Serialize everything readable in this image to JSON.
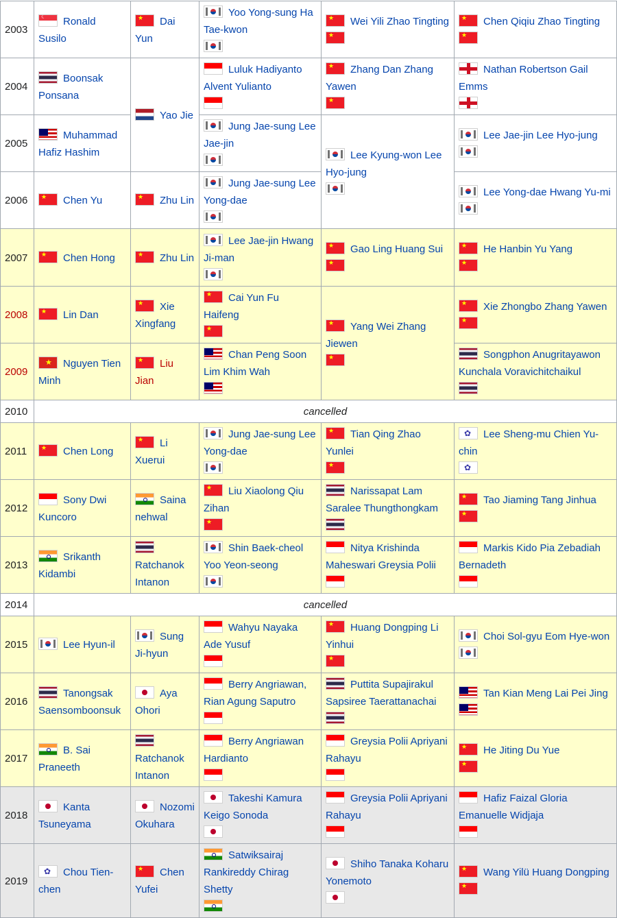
{
  "rows": [
    {
      "year": "2003",
      "shade": "white",
      "ms": {
        "flags": [
          "sg"
        ],
        "names": "Ronald Susilo"
      },
      "ws": {
        "flags": [
          "cn"
        ],
        "names": "Dai Yun"
      },
      "md": {
        "flags": [
          "kr",
          "kr"
        ],
        "names": "Yoo Yong-sung Ha Tae-kwon"
      },
      "wd": {
        "flags": [
          "cn",
          "cn"
        ],
        "names": "Wei Yili Zhao Tingting"
      },
      "xd": {
        "flags": [
          "cn",
          "cn"
        ],
        "names": "Chen Qiqiu Zhao Tingting"
      }
    },
    {
      "year": "2004",
      "shade": "white",
      "ms": {
        "flags": [
          "th"
        ],
        "names": "Boonsak Ponsana"
      },
      "ws": {
        "flags": [
          "nl"
        ],
        "names": "Yao Jie",
        "rowspan": 2
      },
      "md": {
        "flags": [
          "id",
          "id"
        ],
        "names": "Luluk Hadiyanto Alvent Yulianto"
      },
      "wd": {
        "flags": [
          "cn",
          "cn"
        ],
        "names": "Zhang Dan Zhang Yawen"
      },
      "xd": {
        "flags": [
          "en",
          "en"
        ],
        "names": "Nathan Robertson Gail Emms"
      }
    },
    {
      "year": "2005",
      "shade": "white",
      "ms": {
        "flags": [
          "my"
        ],
        "names": "Muhammad Hafiz Hashim"
      },
      "md": {
        "flags": [
          "kr",
          "kr"
        ],
        "names": "Jung Jae-sung Lee Jae-jin"
      },
      "wd": {
        "flags": [
          "kr",
          "kr"
        ],
        "names": "Lee Kyung-won Lee Hyo-jung",
        "rowspan": 2
      },
      "xd": {
        "flags": [
          "kr",
          "kr"
        ],
        "names": "Lee Jae-jin Lee Hyo-jung"
      }
    },
    {
      "year": "2006",
      "shade": "white",
      "ms": {
        "flags": [
          "cn"
        ],
        "names": "Chen Yu"
      },
      "ws": {
        "flags": [
          "cn"
        ],
        "names": "Zhu Lin"
      },
      "md": {
        "flags": [
          "kr",
          "kr"
        ],
        "names": "Jung Jae-sung Lee Yong-dae"
      },
      "xd": {
        "flags": [
          "kr",
          "kr"
        ],
        "names": "Lee Yong-dae Hwang Yu-mi"
      }
    },
    {
      "year": "2007",
      "shade": "yellow",
      "ms": {
        "flags": [
          "cn"
        ],
        "names": "Chen Hong"
      },
      "ws": {
        "flags": [
          "cn"
        ],
        "names": "Zhu Lin"
      },
      "md": {
        "flags": [
          "kr",
          "kr"
        ],
        "names": "Lee Jae-jin Hwang Ji-man"
      },
      "wd": {
        "flags": [
          "cn",
          "cn"
        ],
        "names": "Gao Ling Huang Sui"
      },
      "xd": {
        "flags": [
          "cn",
          "cn"
        ],
        "names": "He Hanbin Yu Yang"
      }
    },
    {
      "year": "2008",
      "shade": "yellow",
      "yearRed": true,
      "ms": {
        "flags": [
          "cn"
        ],
        "names": "Lin Dan"
      },
      "ws": {
        "flags": [
          "cn"
        ],
        "names": "Xie Xingfang"
      },
      "md": {
        "flags": [
          "cn",
          "cn"
        ],
        "names": "Cai Yun Fu Haifeng"
      },
      "wd": {
        "flags": [
          "cn",
          "cn"
        ],
        "names": "Yang Wei Zhang Jiewen",
        "rowspan": 2
      },
      "xd": {
        "flags": [
          "cn",
          "cn"
        ],
        "names": "Xie Zhongbo Zhang Yawen"
      }
    },
    {
      "year": "2009",
      "shade": "yellow",
      "yearRed": true,
      "ms": {
        "flags": [
          "vn"
        ],
        "names": "Nguyen Tien Minh"
      },
      "ws": {
        "flags": [
          "cn"
        ],
        "names": "Liu Jian",
        "red": true
      },
      "md": {
        "flags": [
          "my",
          "my"
        ],
        "names": "Chan Peng Soon Lim Khim Wah"
      },
      "xd": {
        "flags": [
          "th",
          "th"
        ],
        "names": "Songphon Anugritayawon Kunchala Voravichitchaikul"
      }
    },
    {
      "year": "2010",
      "shade": "white",
      "cancelled": "cancelled"
    },
    {
      "year": "2011",
      "shade": "yellow",
      "ms": {
        "flags": [
          "cn"
        ],
        "names": "Chen Long"
      },
      "ws": {
        "flags": [
          "cn"
        ],
        "names": "Li Xuerui"
      },
      "md": {
        "flags": [
          "kr",
          "kr"
        ],
        "names": "Jung Jae-sung Lee Yong-dae"
      },
      "wd": {
        "flags": [
          "cn",
          "cn"
        ],
        "names": "Tian Qing Zhao Yunlei"
      },
      "xd": {
        "flags": [
          "tw",
          "tw"
        ],
        "names": "Lee Sheng-mu Chien Yu-chin"
      }
    },
    {
      "year": "2012",
      "shade": "yellow",
      "ms": {
        "flags": [
          "id"
        ],
        "names": "Sony Dwi Kuncoro"
      },
      "ws": {
        "flags": [
          "in"
        ],
        "names": "Saina nehwal"
      },
      "md": {
        "flags": [
          "cn",
          "cn"
        ],
        "names": "Liu Xiaolong Qiu Zihan"
      },
      "wd": {
        "flags": [
          "th",
          "th"
        ],
        "names": "Narissapat Lam Saralee Thungthongkam"
      },
      "xd": {
        "flags": [
          "cn",
          "cn"
        ],
        "names": "Tao Jiaming Tang Jinhua"
      }
    },
    {
      "year": "2013",
      "shade": "yellow",
      "ms": {
        "flags": [
          "in"
        ],
        "names": "Srikanth Kidambi"
      },
      "ws": {
        "flags": [
          "th"
        ],
        "names": "Ratchanok Intanon"
      },
      "md": {
        "flags": [
          "kr",
          "kr"
        ],
        "names": "Shin Baek-cheol Yoo Yeon-seong"
      },
      "wd": {
        "flags": [
          "id",
          "id"
        ],
        "names": "Nitya Krishinda Maheswari Greysia Polii"
      },
      "xd": {
        "flags": [
          "id",
          "id"
        ],
        "names": "Markis Kido Pia Zebadiah Bernadeth"
      }
    },
    {
      "year": "2014",
      "shade": "white",
      "cancelled": "cancelled"
    },
    {
      "year": "2015",
      "shade": "yellow",
      "ms": {
        "flags": [
          "kr"
        ],
        "names": "Lee Hyun-il"
      },
      "ws": {
        "flags": [
          "kr"
        ],
        "names": "Sung Ji-hyun"
      },
      "md": {
        "flags": [
          "id",
          "id"
        ],
        "names": "Wahyu Nayaka Ade Yusuf"
      },
      "wd": {
        "flags": [
          "cn",
          "cn"
        ],
        "names": "Huang Dongping Li Yinhui"
      },
      "xd": {
        "flags": [
          "kr",
          "kr"
        ],
        "names": "Choi Sol-gyu Eom Hye-won"
      }
    },
    {
      "year": "2016",
      "shade": "yellow",
      "ms": {
        "flags": [
          "th"
        ],
        "names": "Tanongsak Saensomboonsuk"
      },
      "ws": {
        "flags": [
          "jp"
        ],
        "names": "Aya Ohori"
      },
      "md": {
        "flags": [
          "id",
          "id"
        ],
        "names": "Berry Angriawan, Rian Agung Saputro"
      },
      "wd": {
        "flags": [
          "th",
          "th"
        ],
        "names": "Puttita Supajirakul Sapsiree Taerattanachai"
      },
      "xd": {
        "flags": [
          "my",
          "my"
        ],
        "names": "Tan Kian Meng Lai Pei Jing"
      }
    },
    {
      "year": "2017",
      "shade": "yellow",
      "ms": {
        "flags": [
          "in"
        ],
        "names": "B. Sai Praneeth"
      },
      "ws": {
        "flags": [
          "th"
        ],
        "names": "Ratchanok Intanon"
      },
      "md": {
        "flags": [
          "id",
          "id"
        ],
        "names": "Berry Angriawan Hardianto"
      },
      "wd": {
        "flags": [
          "id",
          "id"
        ],
        "names": "Greysia Polii Apriyani Rahayu"
      },
      "xd": {
        "flags": [
          "cn",
          "cn"
        ],
        "names": "He Jiting Du Yue"
      }
    },
    {
      "year": "2018",
      "shade": "grey",
      "ms": {
        "flags": [
          "jp"
        ],
        "names": "Kanta Tsuneyama"
      },
      "ws": {
        "flags": [
          "jp"
        ],
        "names": "Nozomi Okuhara"
      },
      "md": {
        "flags": [
          "jp",
          "jp"
        ],
        "names": "Takeshi Kamura Keigo Sonoda"
      },
      "wd": {
        "flags": [
          "id",
          "id"
        ],
        "names": "Greysia Polii Apriyani Rahayu"
      },
      "xd": {
        "flags": [
          "id",
          "id"
        ],
        "names": "Hafiz Faizal Gloria Emanuelle Widjaja"
      }
    },
    {
      "year": "2019",
      "shade": "grey",
      "ms": {
        "flags": [
          "tw"
        ],
        "names": "Chou Tien-chen"
      },
      "ws": {
        "flags": [
          "cn"
        ],
        "names": "Chen Yufei"
      },
      "md": {
        "flags": [
          "in",
          "in"
        ],
        "names": "Satwiksairaj Rankireddy Chirag Shetty"
      },
      "wd": {
        "flags": [
          "jp",
          "jp"
        ],
        "names": "Shiho Tanaka Koharu Yonemoto"
      },
      "xd": {
        "flags": [
          "cn",
          "cn"
        ],
        "names": "Wang Yilü Huang Dongping"
      }
    }
  ],
  "layout_hints": {
    "flag_icons": [
      "sg",
      "cn",
      "kr",
      "th",
      "nl",
      "id",
      "en",
      "my",
      "vn",
      "tw",
      "in",
      "jp"
    ],
    "colors": {
      "link": "#0645ad",
      "red_link": "#ba0000",
      "row_yellow": "#ffffcc",
      "row_grey": "#e8e8e8",
      "border": "#a2a9b1"
    }
  }
}
